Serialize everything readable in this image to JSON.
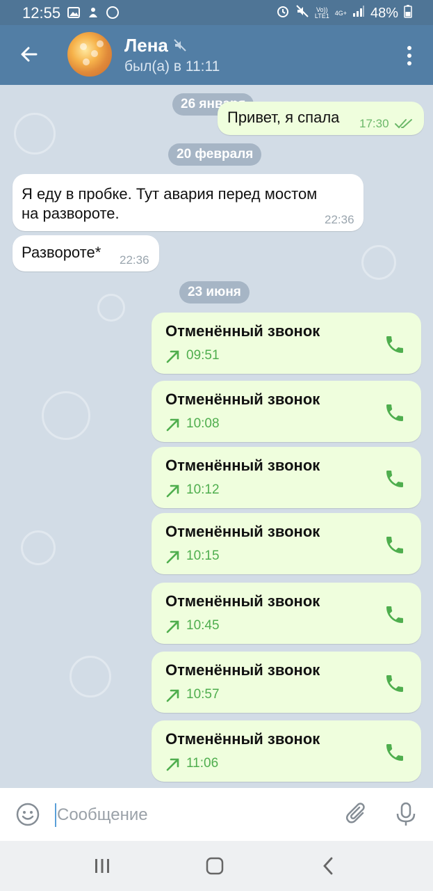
{
  "status_bar": {
    "time": "12:55",
    "network_top": "Vo))",
    "network_bottom": "LTE1",
    "network_type": "4G+",
    "battery": "48%"
  },
  "header": {
    "contact_name": "Лена",
    "contact_status": "был(а) в 11:11"
  },
  "chat": {
    "dates": [
      "26 января",
      "20 февраля",
      "23 июня"
    ],
    "text_messages": [
      {
        "direction": "out",
        "text": "Привет, я спала",
        "time": "17:30"
      },
      {
        "direction": "in",
        "text_line1": "Я еду  в пробке. Тут авария перед мостом",
        "text_line2": "на развороте.",
        "time": "22:36"
      },
      {
        "direction": "in",
        "text": "Развороте*",
        "time": "22:36"
      }
    ],
    "calls": [
      {
        "title": "Отменённый звонок",
        "time": "09:51"
      },
      {
        "title": "Отменённый звонок",
        "time": "10:08"
      },
      {
        "title": "Отменённый звонок",
        "time": "10:12"
      },
      {
        "title": "Отменённый звонок",
        "time": "10:15"
      },
      {
        "title": "Отменённый звонок",
        "time": "10:45"
      },
      {
        "title": "Отменённый звонок",
        "time": "10:57"
      },
      {
        "title": "Отменённый звонок",
        "time": "11:06"
      }
    ]
  },
  "input_bar": {
    "placeholder": "Сообщение"
  },
  "colors": {
    "header": "#527ea5",
    "status_bar": "#4f7596",
    "outgoing_bubble": "#effedd",
    "incoming_bubble": "#ffffff",
    "call_accent": "#4fae4e"
  },
  "icons": {
    "back": "arrow-left-icon",
    "mute": "muted-speaker-icon",
    "menu": "more-vertical-icon",
    "read_status": "double-check-icon",
    "call_direction": "outgoing-arrow-icon",
    "call": "phone-icon",
    "emoji": "smiley-icon",
    "attach": "paperclip-icon",
    "mic": "microphone-icon"
  }
}
